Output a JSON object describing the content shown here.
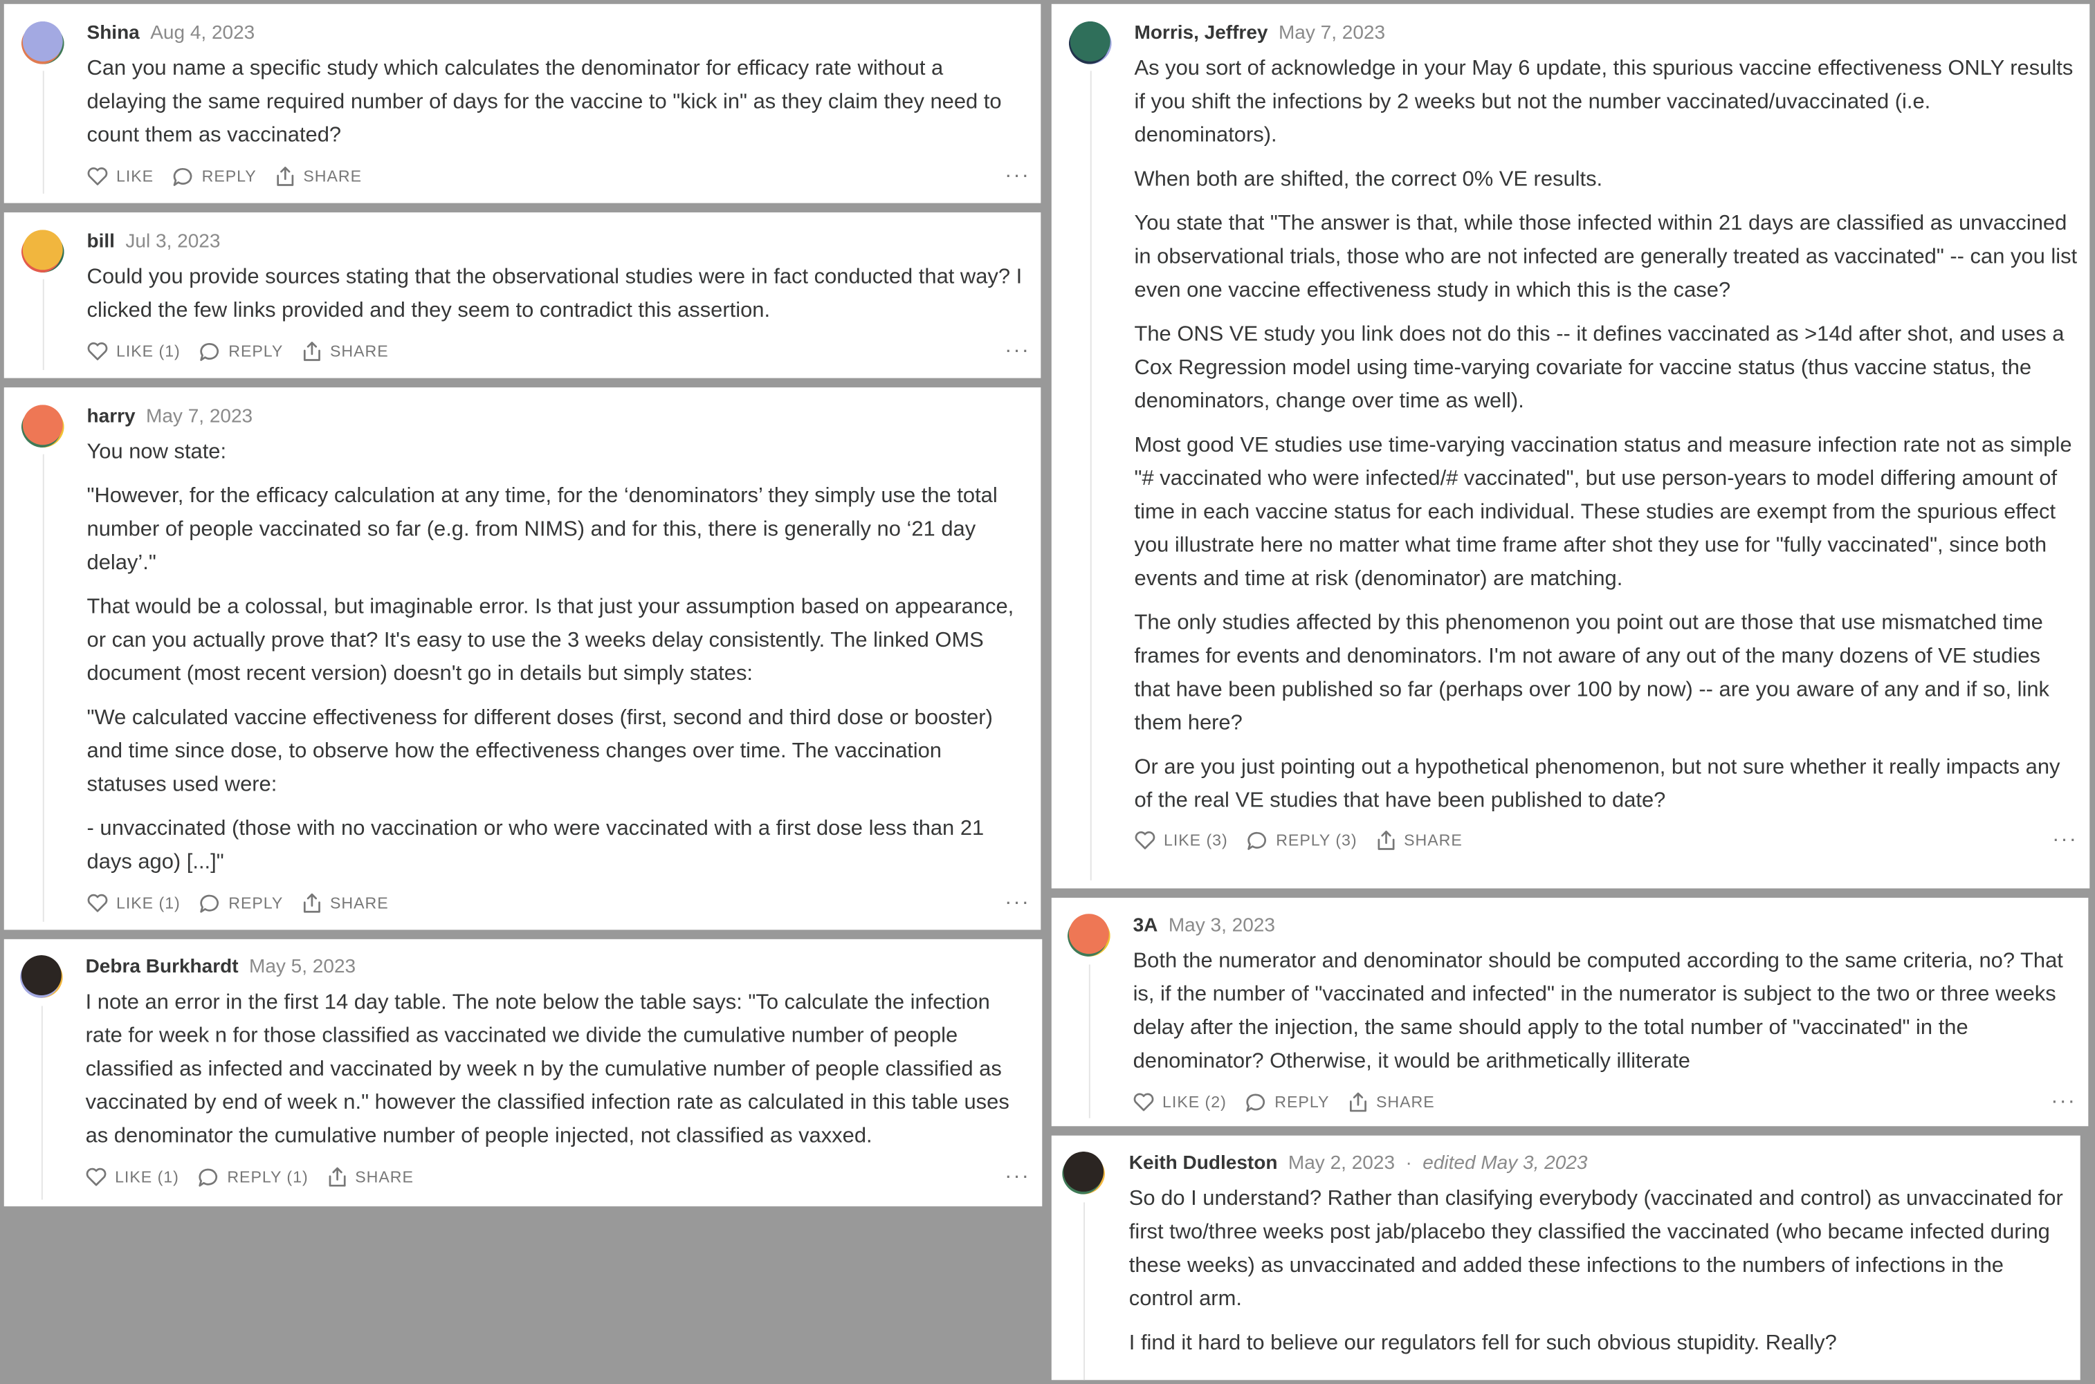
{
  "icons": {
    "like": "heart-icon",
    "reply": "speech-bubble-icon",
    "share": "share-icon",
    "more": "ellipsis-icon"
  },
  "comments": {
    "shina": {
      "author": "Shina",
      "date": "Aug 4, 2023",
      "avatar_colors": [
        "#3f7a57",
        "#e07a50",
        "#a3a9e2"
      ],
      "body": [
        "Can you name a specific study which calculates the denominator for efficacy rate without a delaying the same required number of days for the vaccine to \"kick in\" as they claim they need to count them as vaccinated?"
      ],
      "like": "LIKE",
      "reply": "REPLY",
      "share": "SHARE",
      "more": "···"
    },
    "bill": {
      "author": "bill",
      "date": "Jul 3, 2023",
      "avatar_colors": [
        "#2f6f53",
        "#e35b4b",
        "#f1b63e"
      ],
      "body": [
        "Could you provide sources stating that the observational studies were in fact conducted that way? I clicked the few links provided and they seem to contradict this assertion."
      ],
      "like": "LIKE (1)",
      "reply": "REPLY",
      "share": "SHARE",
      "more": "···"
    },
    "harry": {
      "author": "harry",
      "date": "May 7, 2023",
      "avatar_colors": [
        "#f1c232",
        "#3f7a57",
        "#ee7755"
      ],
      "body": [
        "You now state:",
        "\"However, for the efficacy calculation at any time, for the ‘denominators’ they simply use the total number of people vaccinated so far (e.g. from NIMS) and for this, there is generally no ‘21 day delay’.\"",
        "That would be a colossal, but imaginable error. Is that just your assumption based on appearance, or can you actually prove that? It's easy to use the 3 weeks delay consistently. The linked OMS document (most recent version) doesn't go in details but simply states:",
        "\"We calculated vaccine effectiveness for different doses (first, second and third dose or booster) and time since dose, to observe how the effectiveness changes over time. The vaccination statuses used were:",
        "- unvaccinated (those with no vaccination or who were vaccinated with a first dose less than 21 days ago) [...]\""
      ],
      "like": "LIKE (1)",
      "reply": "REPLY",
      "share": "SHARE",
      "more": "···"
    },
    "debra": {
      "author": "Debra Burkhardt",
      "date": "May 5, 2023",
      "avatar_colors": [
        "#f1b63e",
        "#a3a9e2",
        "#2b2522"
      ],
      "body": [
        "I note an error in the first 14 day table. The note below the table says: \"To calculate the infection rate for week n for those classified as vaccinated we divide the cumulative number of people classified as infected and vaccinated by week n by the cumulative number of people classified as vaccinated by end of week n.\" however the classified infection rate as calculated in this table uses as denominator the cumulative number of people injected, not classified as vaxxed."
      ],
      "like": "LIKE (1)",
      "reply": "REPLY (1)",
      "share": "SHARE",
      "more": "···"
    },
    "morris": {
      "author": "Morris, Jeffrey",
      "date": "May 7, 2023",
      "avatar_colors": [
        "#a3a9e2",
        "#22334d",
        "#2f6f5a"
      ],
      "body": [
        "As you sort of acknowledge in your May 6 update, this spurious vaccine effectiveness ONLY results if you shift the infections by 2 weeks but not the number vaccinated/uvaccinated (i.e. denominators).",
        "When both are shifted, the correct 0% VE results.",
        "You state that \"The answer is that, while those infected within 21 days are classified as unvaccined in observational trials, those who are not infected are generally treated as vaccinated\" -- can you list even one vaccine effectiveness study in which this is the case?",
        "The ONS VE study you link does not do this -- it defines vaccinated as >14d after shot, and uses a Cox Regression model using time-varying covariate for vaccine status (thus vaccine status, the denominators, change over time as well).",
        "Most good VE studies use time-varying vaccination status and measure infection rate not as simple \"# vaccinated who were infected/# vaccinated\", but use person-years to model differing amount of time in each vaccine status for each individual. These studies are exempt from the spurious effect you illustrate here no matter what time frame after shot they use for \"fully vaccinated\", since both events and time at risk (denominator) are matching.",
        "The only studies affected by this phenomenon you point out are those that use mismatched time frames for events and denominators. I'm not aware of any out of the many dozens of VE studies that have been published so far (perhaps over 100 by now) -- are you aware of any and if so, link them here?",
        "Or are you just pointing out a hypothetical phenomenon, but not sure whether it really impacts any of the real VE studies that have been published to date?"
      ],
      "like": "LIKE (3)",
      "reply": "REPLY (3)",
      "share": "SHARE",
      "more": "···"
    },
    "three_a": {
      "author": "3A",
      "date": "May 3, 2023",
      "avatar_colors": [
        "#f1c232",
        "#3f7a57",
        "#ee7755"
      ],
      "body": [
        "Both the numerator and denominator should be computed according to the same criteria, no? That is, if the number of \"vaccinated and infected\" in the numerator is subject to the two or three weeks delay after the injection, the same should apply to the total number of \"vaccinated\" in the denominator? Otherwise, it would be arithmetically illiterate"
      ],
      "like": "LIKE (2)",
      "reply": "REPLY",
      "share": "SHARE",
      "more": "···"
    },
    "keith": {
      "author": "Keith Dudleston",
      "date": "May 2, 2023",
      "separator": "·",
      "edited": "edited May 3, 2023",
      "avatar_colors": [
        "#f1b63e",
        "#3f7a57",
        "#2b2522"
      ],
      "body": [
        "So do I understand? Rather than clasifying everybody (vaccinated and control) as unvaccinated for first two/three weeks post jab/placebo they classified the vaccinated (who became infected during these weeks) as unvaccinated and added these infections to the numbers of infections in the control arm.",
        "I find it hard to believe our regulators fell for such obvious stupidity. Really?"
      ]
    }
  }
}
